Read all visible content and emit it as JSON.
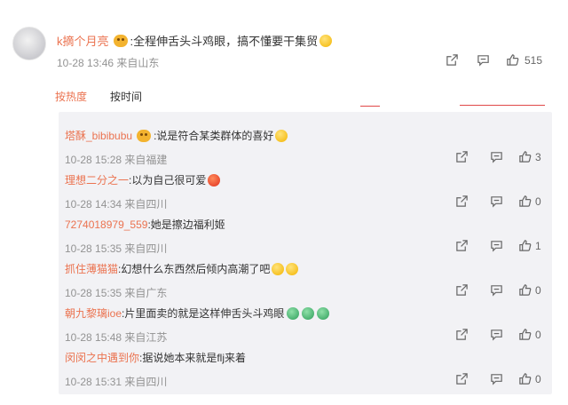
{
  "top_comment": {
    "username": "k摘个月亮",
    "text": ":全程伸舌头斗鸡眼，搞不懂要干集贸",
    "time": "10-28 13:46",
    "location": "来自山东",
    "like_count": "515"
  },
  "sort": {
    "hot": "按热度",
    "time": "按时间"
  },
  "replies": [
    {
      "username": "塔酥_bibibubu",
      "text": ":说是符合某类群体的喜好",
      "time": "10-28 15:28",
      "location": "来自福建",
      "likes": "3",
      "badge": true,
      "emoji": [
        "yellow"
      ]
    },
    {
      "username": "理想二分之一",
      "text": ":以为自己很可爱",
      "time": "10-28 14:34",
      "location": "来自四川",
      "likes": "0",
      "badge": false,
      "emoji": [
        "red"
      ]
    },
    {
      "username": "7274018979_559",
      "text": ":她是擦边福利姬",
      "time": "10-28 15:35",
      "location": "来自四川",
      "likes": "1",
      "badge": false,
      "emoji": []
    },
    {
      "username": "抓住薄猫猫",
      "text": ":幻想什么东西然后倾内高潮了吧",
      "time": "10-28 15:35",
      "location": "来自广东",
      "likes": "0",
      "badge": false,
      "emoji": [
        "yellow",
        "yellow"
      ]
    },
    {
      "username": "朝九黎璃ioe",
      "text": ":片里面卖的就是这样伸舌头斗鸡眼",
      "time": "10-28 15:48",
      "location": "来自江苏",
      "likes": "0",
      "badge": false,
      "emoji": [
        "green",
        "green",
        "green"
      ]
    },
    {
      "username": "闵闵之中遇到你",
      "text": ":据说她本来就是flj来着",
      "time": "10-28 15:31",
      "location": "来自四川",
      "likes": "0",
      "badge": false,
      "emoji": []
    }
  ],
  "icons": [
    "share-icon",
    "comment-icon",
    "like-icon"
  ],
  "colors": {
    "username": "#eb7350",
    "meta": "#939393",
    "reply_bg": "#f2f2f5",
    "annotation": "#e04848"
  }
}
